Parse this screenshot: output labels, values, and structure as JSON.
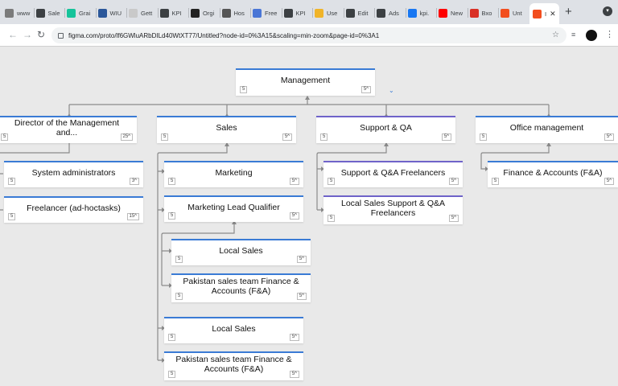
{
  "tabs": [
    {
      "label": "www",
      "color": "#7b7b7b"
    },
    {
      "label": "Sale",
      "color": "#3c4043"
    },
    {
      "label": "Grai",
      "color": "#15c39a"
    },
    {
      "label": "WIU",
      "color": "#2b579a"
    },
    {
      "label": "Gett",
      "color": "#c9c9c9"
    },
    {
      "label": "KPI",
      "color": "#3c4043"
    },
    {
      "label": "Orgi",
      "color": "#222222"
    },
    {
      "label": "Hos",
      "color": "#555555"
    },
    {
      "label": "Free",
      "color": "#4a76d6"
    },
    {
      "label": "KPI",
      "color": "#3c4043"
    },
    {
      "label": "Use",
      "color": "#f0b429"
    },
    {
      "label": "Edit",
      "color": "#3c4043"
    },
    {
      "label": "Ads",
      "color": "#3c4043"
    },
    {
      "label": "kpi.",
      "color": "#1877f2"
    },
    {
      "label": "New",
      "color": "#ff0000"
    },
    {
      "label": "Bxo",
      "color": "#d93025"
    },
    {
      "label": "Unt",
      "color": "#f24e1e"
    }
  ],
  "active_tab": {
    "label": "I",
    "color": "#f24e1e"
  },
  "url": "figma.com/proto/lf6GWluARbDILd40WtXT77/Untitled?node-id=0%3A15&scaling=min-zoom&page-id=0%3A1",
  "nodes": {
    "management": {
      "label": "Management",
      "left": "5",
      "right": "5"
    },
    "director": {
      "label": "Director of the Management and...",
      "left": "5",
      "right": "25"
    },
    "sales": {
      "label": "Sales",
      "left": "5",
      "right": "5"
    },
    "support": {
      "label": "Support & QA",
      "left": "5",
      "right": "5"
    },
    "office": {
      "label": "Office management",
      "left": "5",
      "right": "5"
    },
    "sysadmins": {
      "label": "System administrators",
      "left": "5",
      "right": "3"
    },
    "freelancer": {
      "label": "Freelancer (ad-hoctasks)",
      "left": "5",
      "right": "15"
    },
    "marketing": {
      "label": "Marketing",
      "left": "5",
      "right": "5"
    },
    "mlq": {
      "label": "Marketing Lead Qualifier",
      "left": "5",
      "right": "5"
    },
    "local_sales_inner": {
      "label": "Local Sales",
      "left": "5",
      "right": "5"
    },
    "pakistan_inner": {
      "label": "Pakistan sales team Finance & Accounts (F&A)",
      "left": "5",
      "right": "5"
    },
    "local_sales": {
      "label": "Local Sales",
      "left": "5",
      "right": "5"
    },
    "pakistan": {
      "label": "Pakistan sales team Finance & Accounts (F&A)",
      "left": "5",
      "right": "5"
    },
    "support_freelancers": {
      "label": "Support & Q&A Freelancers",
      "left": "5",
      "right": "5"
    },
    "local_support": {
      "label": "Local Sales Support & Q&A Freelancers",
      "left": "5",
      "right": "5"
    },
    "fa": {
      "label": "Finance & Accounts (F&A)",
      "left": "5",
      "right": "5"
    }
  }
}
